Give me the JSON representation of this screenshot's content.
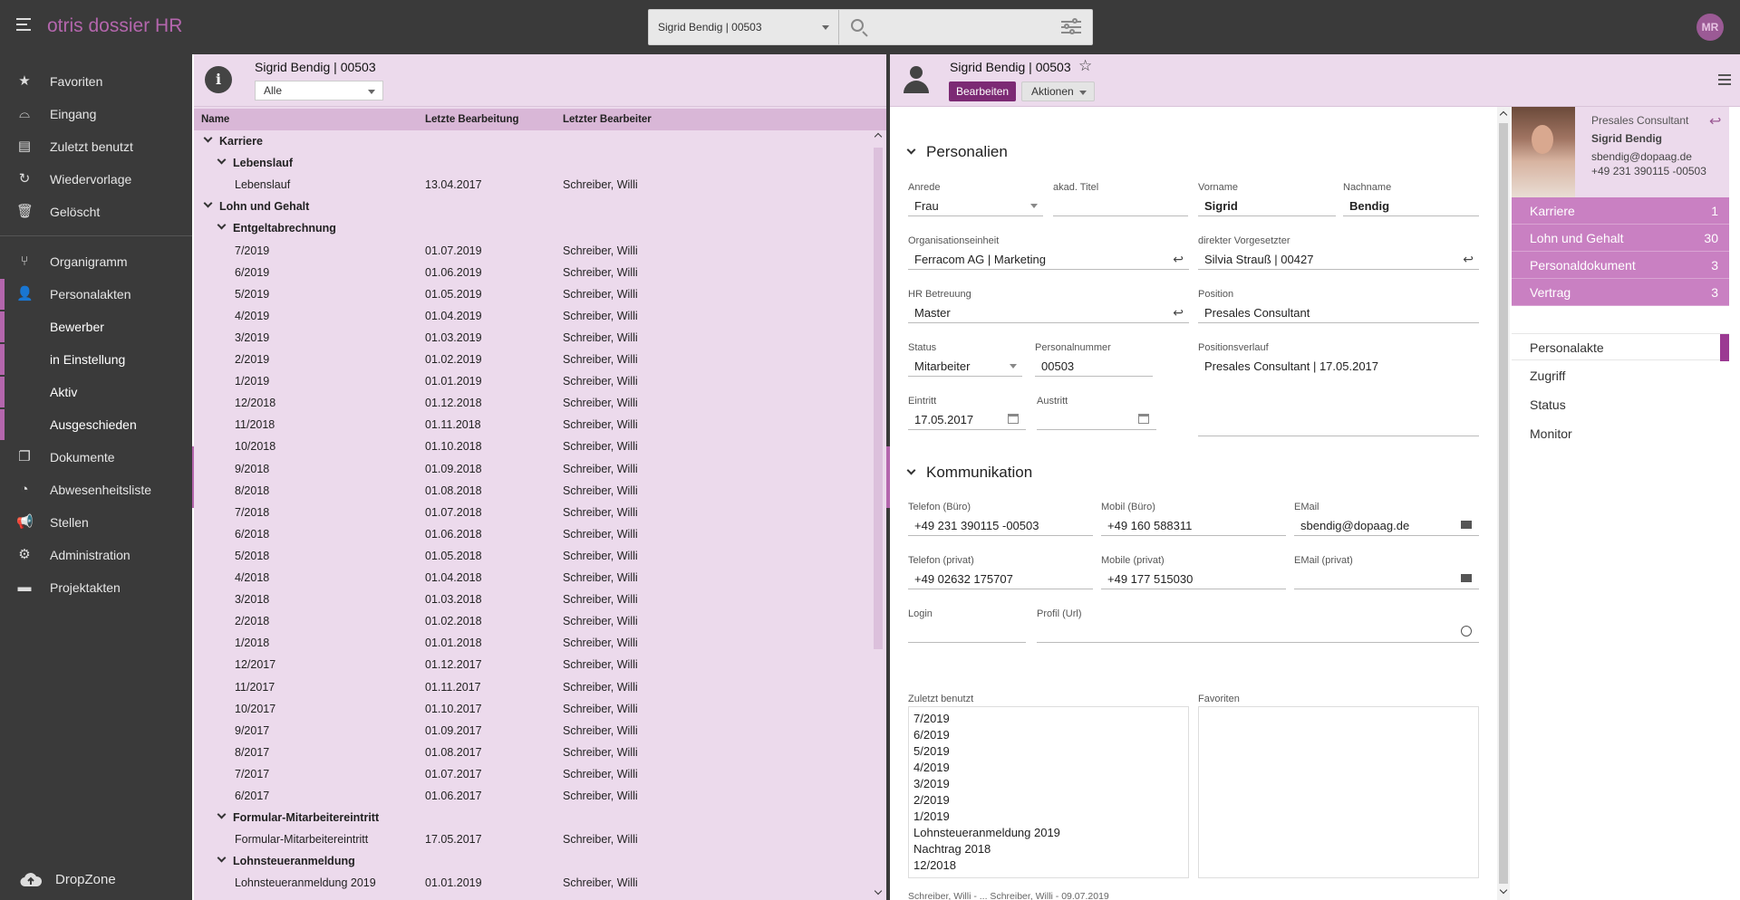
{
  "app": {
    "title": "otris dossier HR",
    "user_initials": "MR"
  },
  "search": {
    "scope": "Sigrid Bendig | 00503",
    "placeholder": ""
  },
  "sidebar": {
    "items": [
      {
        "label": "Favoriten",
        "icon": "star-icon"
      },
      {
        "label": "Eingang",
        "icon": "inbox-icon"
      },
      {
        "label": "Zuletzt benutzt",
        "icon": "clipboard-icon"
      },
      {
        "label": "Wiedervorlage",
        "icon": "refresh-icon"
      },
      {
        "label": "Gelöscht",
        "icon": "trash-icon"
      },
      {
        "label": "Organigramm",
        "icon": "org-chart-icon"
      },
      {
        "label": "Personalakten",
        "icon": "person-icon"
      },
      {
        "label": "Dokumente",
        "icon": "documents-icon"
      },
      {
        "label": "Abwesenheitsliste",
        "icon": "absence-icon"
      },
      {
        "label": "Stellen",
        "icon": "megaphone-icon"
      },
      {
        "label": "Administration",
        "icon": "gear-icon"
      },
      {
        "label": "Projektakten",
        "icon": "folder-icon"
      }
    ],
    "subitems": [
      "Bewerber",
      "in Einstellung",
      "Aktiv",
      "Ausgeschieden"
    ],
    "dropzone": "DropZone"
  },
  "tree": {
    "title": "Sigrid Bendig | 00503",
    "filter": "Alle",
    "columns": [
      "Name",
      "Letzte Bearbeitung",
      "Letzter Bearbeiter"
    ],
    "rows": [
      {
        "level": 0,
        "group": true,
        "name": "Karriere",
        "date": "",
        "editor": ""
      },
      {
        "level": 1,
        "group": true,
        "name": "Lebenslauf",
        "date": "",
        "editor": ""
      },
      {
        "level": 2,
        "group": false,
        "name": "Lebenslauf",
        "date": "13.04.2017",
        "editor": "Schreiber, Willi"
      },
      {
        "level": 0,
        "group": true,
        "name": "Lohn und Gehalt",
        "date": "",
        "editor": ""
      },
      {
        "level": 1,
        "group": true,
        "name": "Entgeltabrechnung",
        "date": "",
        "editor": ""
      },
      {
        "level": 2,
        "group": false,
        "name": "7/2019",
        "date": "01.07.2019",
        "editor": "Schreiber, Willi"
      },
      {
        "level": 2,
        "group": false,
        "name": "6/2019",
        "date": "01.06.2019",
        "editor": "Schreiber, Willi"
      },
      {
        "level": 2,
        "group": false,
        "name": "5/2019",
        "date": "01.05.2019",
        "editor": "Schreiber, Willi"
      },
      {
        "level": 2,
        "group": false,
        "name": "4/2019",
        "date": "01.04.2019",
        "editor": "Schreiber, Willi"
      },
      {
        "level": 2,
        "group": false,
        "name": "3/2019",
        "date": "01.03.2019",
        "editor": "Schreiber, Willi"
      },
      {
        "level": 2,
        "group": false,
        "name": "2/2019",
        "date": "01.02.2019",
        "editor": "Schreiber, Willi"
      },
      {
        "level": 2,
        "group": false,
        "name": "1/2019",
        "date": "01.01.2019",
        "editor": "Schreiber, Willi"
      },
      {
        "level": 2,
        "group": false,
        "name": "12/2018",
        "date": "01.12.2018",
        "editor": "Schreiber, Willi"
      },
      {
        "level": 2,
        "group": false,
        "name": "11/2018",
        "date": "01.11.2018",
        "editor": "Schreiber, Willi"
      },
      {
        "level": 2,
        "group": false,
        "name": "10/2018",
        "date": "01.10.2018",
        "editor": "Schreiber, Willi"
      },
      {
        "level": 2,
        "group": false,
        "name": "9/2018",
        "date": "01.09.2018",
        "editor": "Schreiber, Willi"
      },
      {
        "level": 2,
        "group": false,
        "name": "8/2018",
        "date": "01.08.2018",
        "editor": "Schreiber, Willi"
      },
      {
        "level": 2,
        "group": false,
        "name": "7/2018",
        "date": "01.07.2018",
        "editor": "Schreiber, Willi"
      },
      {
        "level": 2,
        "group": false,
        "name": "6/2018",
        "date": "01.06.2018",
        "editor": "Schreiber, Willi"
      },
      {
        "level": 2,
        "group": false,
        "name": "5/2018",
        "date": "01.05.2018",
        "editor": "Schreiber, Willi"
      },
      {
        "level": 2,
        "group": false,
        "name": "4/2018",
        "date": "01.04.2018",
        "editor": "Schreiber, Willi"
      },
      {
        "level": 2,
        "group": false,
        "name": "3/2018",
        "date": "01.03.2018",
        "editor": "Schreiber, Willi"
      },
      {
        "level": 2,
        "group": false,
        "name": "2/2018",
        "date": "01.02.2018",
        "editor": "Schreiber, Willi"
      },
      {
        "level": 2,
        "group": false,
        "name": "1/2018",
        "date": "01.01.2018",
        "editor": "Schreiber, Willi"
      },
      {
        "level": 2,
        "group": false,
        "name": "12/2017",
        "date": "01.12.2017",
        "editor": "Schreiber, Willi"
      },
      {
        "level": 2,
        "group": false,
        "name": "11/2017",
        "date": "01.11.2017",
        "editor": "Schreiber, Willi"
      },
      {
        "level": 2,
        "group": false,
        "name": "10/2017",
        "date": "01.10.2017",
        "editor": "Schreiber, Willi"
      },
      {
        "level": 2,
        "group": false,
        "name": "9/2017",
        "date": "01.09.2017",
        "editor": "Schreiber, Willi"
      },
      {
        "level": 2,
        "group": false,
        "name": "8/2017",
        "date": "01.08.2017",
        "editor": "Schreiber, Willi"
      },
      {
        "level": 2,
        "group": false,
        "name": "7/2017",
        "date": "01.07.2017",
        "editor": "Schreiber, Willi"
      },
      {
        "level": 2,
        "group": false,
        "name": "6/2017",
        "date": "01.06.2017",
        "editor": "Schreiber, Willi"
      },
      {
        "level": 1,
        "group": true,
        "name": "Formular-Mitarbeitereintritt",
        "date": "",
        "editor": ""
      },
      {
        "level": 2,
        "group": false,
        "name": "Formular-Mitarbeitereintritt",
        "date": "17.05.2017",
        "editor": "Schreiber, Willi"
      },
      {
        "level": 1,
        "group": true,
        "name": "Lohnsteueranmeldung",
        "date": "",
        "editor": ""
      },
      {
        "level": 2,
        "group": false,
        "name": "Lohnsteueranmeldung 2019",
        "date": "01.01.2019",
        "editor": "Schreiber, Willi"
      }
    ]
  },
  "detail": {
    "title": "Sigrid Bendig | 00503",
    "edit_label": "Bearbeiten",
    "actions_label": "Aktionen",
    "sections": {
      "personalien": "Personalien",
      "kommunikation": "Kommunikation"
    },
    "fields": {
      "anrede": {
        "label": "Anrede",
        "value": "Frau"
      },
      "titel": {
        "label": "akad. Titel",
        "value": ""
      },
      "vorname": {
        "label": "Vorname",
        "value": "Sigrid"
      },
      "nachname": {
        "label": "Nachname",
        "value": "Bendig"
      },
      "orgeinheit": {
        "label": "Organisationseinheit",
        "value": "Ferracom AG | Marketing"
      },
      "vorgesetzter": {
        "label": "direkter Vorgesetzter",
        "value": "Silvia Strauß | 00427"
      },
      "hr": {
        "label": "HR Betreuung",
        "value": "Master"
      },
      "position": {
        "label": "Position",
        "value": "Presales Consultant"
      },
      "status": {
        "label": "Status",
        "value": "Mitarbeiter"
      },
      "personalnummer": {
        "label": "Personalnummer",
        "value": "00503"
      },
      "positionsverlauf": {
        "label": "Positionsverlauf",
        "value": "Presales Consultant | 17.05.2017"
      },
      "eintritt": {
        "label": "Eintritt",
        "value": "17.05.2017"
      },
      "austritt": {
        "label": "Austritt",
        "value": ""
      },
      "tel_buero": {
        "label": "Telefon (Büro)",
        "value": "+49 231 390115 -00503"
      },
      "mobil_buero": {
        "label": "Mobil (Büro)",
        "value": "+49 160 588311"
      },
      "email": {
        "label": "EMail",
        "value": "sbendig@dopaag.de"
      },
      "tel_privat": {
        "label": "Telefon (privat)",
        "value": "+49 02632 175707"
      },
      "mobil_privat": {
        "label": "Mobile (privat)",
        "value": "+49 177 515030"
      },
      "email_privat": {
        "label": "EMail (privat)",
        "value": ""
      },
      "login": {
        "label": "Login",
        "value": ""
      },
      "profil": {
        "label": "Profil (Url)",
        "value": ""
      }
    },
    "recent": {
      "label": "Zuletzt benutzt",
      "items": [
        "7/2019",
        "6/2019",
        "5/2019",
        "4/2019",
        "3/2019",
        "2/2019",
        "1/2019",
        "Lohnsteueranmeldung 2019",
        "Nachtrag 2018",
        "12/2018"
      ]
    },
    "favorites": {
      "label": "Favoriten"
    },
    "footer": "Schreiber, Willi - ... Schreiber, Willi - 09.07.2019"
  },
  "profile": {
    "role": "Presales Consultant",
    "name": "Sigrid Bendig",
    "email": "sbendig@dopaag.de",
    "phone": "+49 231 390115 -00503",
    "categories": [
      {
        "label": "Karriere",
        "count": "1"
      },
      {
        "label": "Lohn und Gehalt",
        "count": "30"
      },
      {
        "label": "Personaldokument",
        "count": "3"
      },
      {
        "label": "Vertrag",
        "count": "3"
      }
    ],
    "tabs": [
      "Personalakte",
      "Zugriff",
      "Status",
      "Monitor"
    ]
  }
}
